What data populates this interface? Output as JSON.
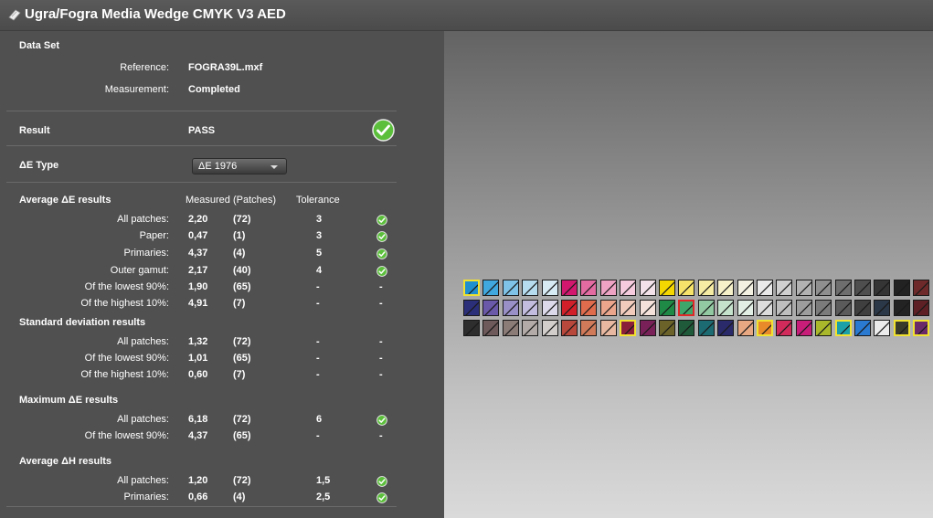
{
  "window": {
    "title": "Ugra/Fogra Media Wedge CMYK V3 AED",
    "title_icon": "wedge-document-icon"
  },
  "dataset": {
    "heading": "Data Set",
    "reference_label": "Reference:",
    "reference_value": "FOGRA39L.mxf",
    "measurement_label": "Measurement:",
    "measurement_value": "Completed"
  },
  "result": {
    "label": "Result",
    "value": "PASS",
    "status_icon": "check-circle-icon"
  },
  "de_type": {
    "label": "ΔE Type",
    "selected": "ΔE 1976"
  },
  "avg_de": {
    "heading": "Average ΔE results",
    "col_measured": "Measured (Patches)",
    "col_tolerance": "Tolerance",
    "rows": [
      {
        "label": "All patches:",
        "measured": "2,20",
        "patches": "(72)",
        "tolerance": "3",
        "status": "check"
      },
      {
        "label": "Paper:",
        "measured": "0,47",
        "patches": "(1)",
        "tolerance": "3",
        "status": "check"
      },
      {
        "label": "Primaries:",
        "measured": "4,37",
        "patches": "(4)",
        "tolerance": "5",
        "status": "check"
      },
      {
        "label": "Outer gamut:",
        "measured": "2,17",
        "patches": "(40)",
        "tolerance": "4",
        "status": "check"
      },
      {
        "label": "Of the lowest 90%:",
        "measured": "1,90",
        "patches": "(65)",
        "tolerance": "-",
        "status": "-"
      },
      {
        "label": "Of the highest 10%:",
        "measured": "4,91",
        "patches": "(7)",
        "tolerance": "-",
        "status": "-"
      }
    ]
  },
  "std_dev": {
    "heading": "Standard deviation results",
    "rows": [
      {
        "label": "All patches:",
        "measured": "1,32",
        "patches": "(72)",
        "tolerance": "-",
        "status": "-"
      },
      {
        "label": "Of the lowest 90%:",
        "measured": "1,01",
        "patches": "(65)",
        "tolerance": "-",
        "status": "-"
      },
      {
        "label": "Of the highest 10%:",
        "measured": "0,60",
        "patches": "(7)",
        "tolerance": "-",
        "status": "-"
      }
    ]
  },
  "max_de": {
    "heading": "Maximum ΔE results",
    "rows": [
      {
        "label": "All patches:",
        "measured": "6,18",
        "patches": "(72)",
        "tolerance": "6",
        "status": "check"
      },
      {
        "label": "Of the lowest 90%:",
        "measured": "4,37",
        "patches": "(65)",
        "tolerance": "-",
        "status": "-"
      }
    ]
  },
  "avg_dh": {
    "heading": "Average ΔH results",
    "rows": [
      {
        "label": "All patches:",
        "measured": "1,20",
        "patches": "(72)",
        "tolerance": "1,5",
        "status": "check"
      },
      {
        "label": "Primaries:",
        "measured": "0,66",
        "patches": "(4)",
        "tolerance": "2,5",
        "status": "check"
      }
    ]
  },
  "colors": {
    "check_green": "#5cbf3c",
    "highlight_yellow": "#f2e230",
    "highlight_red": "#e02828",
    "panel": "#505050"
  },
  "wedge": {
    "rows": [
      [
        [
          "#1f8fcf",
          "#1a1a1a",
          "y"
        ],
        [
          "#40a8de",
          "#1a1a1a",
          ""
        ],
        [
          "#7fc4e8",
          "#1a1a1a",
          ""
        ],
        [
          "#b6dcef",
          "#1a1a1a",
          ""
        ],
        [
          "#d6ebf4",
          "#1a1a1a",
          ""
        ],
        [
          "#d2176f",
          "#1a1a1a",
          ""
        ],
        [
          "#e46aa2",
          "#1a1a1a",
          ""
        ],
        [
          "#efa3c4",
          "#1a1a1a",
          ""
        ],
        [
          "#f5cbdd",
          "#1a1a1a",
          ""
        ],
        [
          "#f3e2ea",
          "#1a1a1a",
          ""
        ],
        [
          "#f4d700",
          "#1a1a1a",
          ""
        ],
        [
          "#f6e46a",
          "#1a1a1a",
          ""
        ],
        [
          "#f7eca3",
          "#1a1a1a",
          ""
        ],
        [
          "#f6f1c9",
          "#1a1a1a",
          ""
        ],
        [
          "#f3f1e1",
          "#1a1a1a",
          ""
        ],
        [
          "#eaeaea",
          "#1a1a1a",
          ""
        ],
        [
          "#cfcfcf",
          "#1a1a1a",
          ""
        ],
        [
          "#b2b2b2",
          "#1a1a1a",
          ""
        ],
        [
          "#8f8f8f",
          "#1a1a1a",
          ""
        ],
        [
          "#6e6e6e",
          "#1a1a1a",
          ""
        ],
        [
          "#4e4e4e",
          "#1a1a1a",
          ""
        ],
        [
          "#353535",
          "#1a1a1a",
          ""
        ],
        [
          "#222222",
          "#1a1a1a",
          ""
        ],
        [
          "#6e2a2a",
          "#1a1a1a",
          ""
        ],
        [
          "#5e5a33",
          "#1a1a1a",
          ""
        ]
      ],
      [
        [
          "#2b2f7a",
          "#1a1a1a",
          ""
        ],
        [
          "#6a58a8",
          "#1a1a1a",
          ""
        ],
        [
          "#9a90c8",
          "#1a1a1a",
          ""
        ],
        [
          "#c2bcdf",
          "#1a1a1a",
          ""
        ],
        [
          "#dcd9ea",
          "#1a1a1a",
          ""
        ],
        [
          "#d2202a",
          "#1a1a1a",
          ""
        ],
        [
          "#e06c4e",
          "#1a1a1a",
          ""
        ],
        [
          "#eba58c",
          "#1a1a1a",
          ""
        ],
        [
          "#f2cbbd",
          "#1a1a1a",
          ""
        ],
        [
          "#f4e2db",
          "#1a1a1a",
          ""
        ],
        [
          "#1f8a46",
          "#1a1a1a",
          ""
        ],
        [
          "#3ea66a",
          "#1a1a1a",
          "r"
        ],
        [
          "#93c9a2",
          "#1a1a1a",
          ""
        ],
        [
          "#c5e2cc",
          "#1a1a1a",
          ""
        ],
        [
          "#e1efe4",
          "#1a1a1a",
          ""
        ],
        [
          "#dcdcdc",
          "#1a1a1a",
          ""
        ],
        [
          "#bebebe",
          "#1a1a1a",
          ""
        ],
        [
          "#9d9d9d",
          "#1a1a1a",
          ""
        ],
        [
          "#7b7b7b",
          "#1a1a1a",
          ""
        ],
        [
          "#5b5b5b",
          "#1a1a1a",
          ""
        ],
        [
          "#3f3f3f",
          "#1a1a1a",
          ""
        ],
        [
          "#2a3848",
          "#1a1a1a",
          ""
        ],
        [
          "#232323",
          "#1a1a1a",
          ""
        ],
        [
          "#5e2024",
          "#1a1a1a",
          ""
        ],
        [
          "#2c4a3a",
          "#1a1a1a",
          ""
        ]
      ],
      [
        [
          "#2e2e2e",
          "#1a1a1a",
          ""
        ],
        [
          "#6e5a5a",
          "#1a1a1a",
          ""
        ],
        [
          "#8c7c78",
          "#1a1a1a",
          ""
        ],
        [
          "#b3aba7",
          "#1a1a1a",
          ""
        ],
        [
          "#d2cecb",
          "#1a1a1a",
          ""
        ],
        [
          "#b8483c",
          "#1a1a1a",
          ""
        ],
        [
          "#d07a5a",
          "#1a1a1a",
          ""
        ],
        [
          "#e8b9a0",
          "#1a1a1a",
          ""
        ],
        [
          "#8a1f3a",
          "#1a1a1a",
          "y"
        ],
        [
          "#7a2058",
          "#1a1a1a",
          ""
        ],
        [
          "#6a6228",
          "#1a1a1a",
          ""
        ],
        [
          "#1f5a3a",
          "#1a1a1a",
          ""
        ],
        [
          "#1c6a72",
          "#1a1a1a",
          ""
        ],
        [
          "#2a2a6a",
          "#1a1a1a",
          ""
        ],
        [
          "#e8a882",
          "#1a1a1a",
          ""
        ],
        [
          "#e88a2a",
          "#1a1a1a",
          "y"
        ],
        [
          "#d22a5a",
          "#1a1a1a",
          ""
        ],
        [
          "#c81e7a",
          "#1a1a1a",
          ""
        ],
        [
          "#a8b82a",
          "#1a1a1a",
          ""
        ],
        [
          "#1aa0a8",
          "#1a1a1a",
          "y"
        ],
        [
          "#2a7ad2",
          "#1a1a1a",
          ""
        ],
        [
          "#ececec",
          "#1a1a1a",
          ""
        ],
        [
          "#3a3a2a",
          "#1a1a1a",
          "y"
        ],
        [
          "#6a2a6a",
          "#1a1a1a",
          "y"
        ],
        [
          "#1a4a5a",
          "#1a1a1a",
          ""
        ]
      ]
    ]
  }
}
